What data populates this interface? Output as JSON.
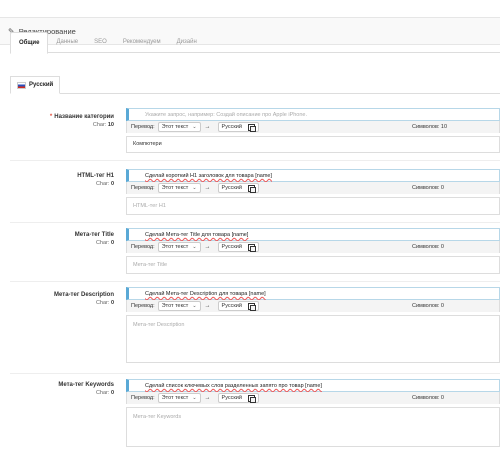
{
  "panel": {
    "heading": "Редактирование",
    "heading_icon": "pencil-icon"
  },
  "tabs": [
    "Общие",
    "Данные",
    "SEO",
    "Рекомендуем",
    "Дизайн"
  ],
  "language_tab": {
    "label": "Русский",
    "flag_icon": "russia-flag-icon"
  },
  "translate_label": "Перевод:",
  "fields": [
    {
      "label": "Название категории",
      "required": true,
      "char_label": "Char:",
      "char_value": "10",
      "prompt": "Укажите запрос, например: Создай описание про Apple iPhone.",
      "prompt_is_placeholder": true,
      "source": "Этот текст",
      "target": "Русский",
      "symbols": "Символов: 10",
      "value": "Компютери",
      "placeholder": ""
    },
    {
      "label": "HTML-тег H1",
      "required": false,
      "char_label": "Char:",
      "char_value": "0",
      "prompt": "Сделай короткий H1 заголовок для товара [name]",
      "source": "Этот текст",
      "target": "Русский",
      "symbols": "Символов: 0",
      "value": "",
      "placeholder": "HTML-тег H1"
    },
    {
      "label": "Мета-тег Title",
      "required": false,
      "char_label": "Char:",
      "char_value": "0",
      "prompt": "Сделай Мета-тег Title для товара [name]",
      "source": "Этот текст",
      "target": "Русский",
      "symbols": "Символов: 0",
      "value": "",
      "placeholder": "Мета-тег Title"
    },
    {
      "label": "Мета-тег Description",
      "required": false,
      "char_label": "Char:",
      "char_value": "0",
      "prompt": "Сделай Мета-тег Description для товара [name]",
      "source": "Этот текст",
      "target": "Русский",
      "symbols": "Символов: 0",
      "value": "",
      "placeholder": "Мета-тег Description"
    },
    {
      "label": "Мета-тег Keywords",
      "required": false,
      "char_label": "Char:",
      "char_value": "0",
      "prompt": "Сделай список ключевых слов разделенных запято про товар [name]",
      "source": "Этот текст",
      "target": "Русский",
      "symbols": "Символов: 0",
      "value": "",
      "placeholder": "Мета-тег Keywords"
    }
  ]
}
